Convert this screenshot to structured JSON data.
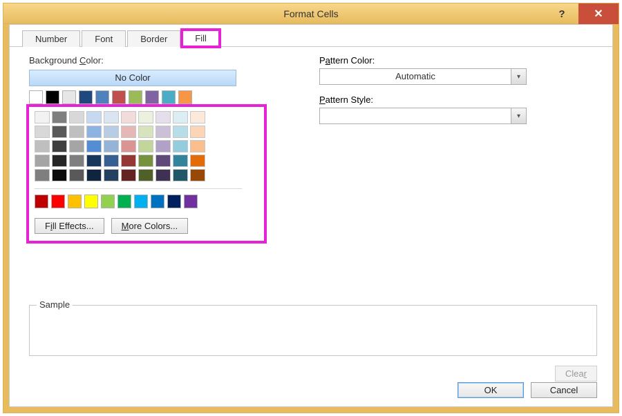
{
  "window": {
    "title": "Format Cells"
  },
  "tabs": [
    "Number",
    "Font",
    "Border",
    "Fill"
  ],
  "active_tab_index": 3,
  "left": {
    "bg_label": "Background Color:",
    "no_color": "No Color",
    "fill_effects": "Fill Effects...",
    "more_colors": "More Colors...",
    "row_top": [
      "#ffffff",
      "#000000",
      "#e7e6e6",
      "#1f497d",
      "#4f81bd",
      "#c0504d",
      "#9bbb59",
      "#8064a2",
      "#4bacc6",
      "#f79646"
    ],
    "theme": [
      "#f2f2f2",
      "#7f7f7f",
      "#d8d8d8",
      "#c6d9f0",
      "#dbe5f1",
      "#f2dbdb",
      "#eaf1dd",
      "#e5dfec",
      "#daeef3",
      "#fde9d9",
      "#d8d8d8",
      "#595959",
      "#bfbfbf",
      "#8db3e2",
      "#b8cce4",
      "#e5b8b7",
      "#d6e3bc",
      "#ccc0d9",
      "#b6dde8",
      "#fbd5b5",
      "#bfbfbf",
      "#3f3f3f",
      "#a5a5a5",
      "#548dd4",
      "#95b3d7",
      "#d99594",
      "#c2d69b",
      "#b2a1c7",
      "#93cddd",
      "#fabf8f",
      "#a5a5a5",
      "#262626",
      "#7f7f7f",
      "#17365d",
      "#366092",
      "#953734",
      "#76923c",
      "#5f497a",
      "#31849b",
      "#e36c09",
      "#7f7f7f",
      "#0c0c0c",
      "#595959",
      "#0f243e",
      "#244061",
      "#632423",
      "#4f6128",
      "#3f3151",
      "#205867",
      "#974806"
    ],
    "standard": [
      "#c00000",
      "#ff0000",
      "#ffc000",
      "#ffff00",
      "#92d050",
      "#00b050",
      "#00b0f0",
      "#0070c0",
      "#002060",
      "#7030a0"
    ]
  },
  "right": {
    "pattern_color_label": "Pattern Color:",
    "pattern_color_value": "Automatic",
    "pattern_style_label": "Pattern Style:",
    "pattern_style_value": ""
  },
  "sample_label": "Sample",
  "buttons": {
    "clear": "Clear",
    "ok": "OK",
    "cancel": "Cancel"
  }
}
